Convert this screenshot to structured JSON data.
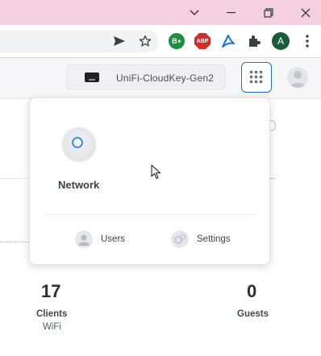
{
  "browser": {
    "window_controls": [
      "minimize",
      "restore",
      "close"
    ],
    "toolbar_icons": [
      "send-icon",
      "star-icon",
      "extension-b-icon",
      "adblock-icon",
      "acrobat-icon",
      "puzzle-icon",
      "profile-icon",
      "menu-icon"
    ],
    "ext_b_label": "B+",
    "abp_label": "ABP",
    "profile_initial": "A"
  },
  "header": {
    "device_name": "UniFi-CloudKey-Gen2"
  },
  "apps_popup": {
    "apps": [
      {
        "label": "Network",
        "icon": "network-app-icon"
      }
    ],
    "links": [
      {
        "label": "Users",
        "icon": "users-icon"
      },
      {
        "label": "Settings",
        "icon": "settings-gear-icon"
      }
    ]
  },
  "stats": {
    "clients": {
      "value": "17",
      "label": "Clients",
      "sublabel": "WiFi"
    },
    "guests": {
      "value": "0",
      "label": "Guests"
    }
  },
  "colors": {
    "titlebar": "#f5d0df",
    "accent": "#1d6fd9",
    "ext_green": "#1e8e3e",
    "abp_red": "#d12d2d",
    "profile_green": "#1a5c3a"
  }
}
